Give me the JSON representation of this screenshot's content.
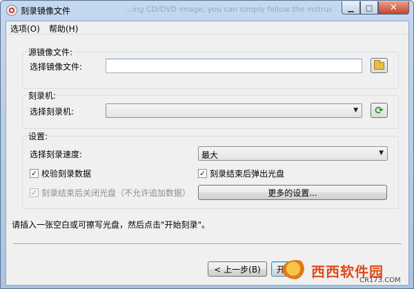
{
  "window": {
    "title": "刻录镜像文件",
    "title_ghost": "...ing CD/DVD image, you can simply follow the instructions in the program to"
  },
  "menu": {
    "options": "选项(O)",
    "help": "帮助(H)"
  },
  "source_group": {
    "title": "源镜像文件:",
    "field_label": "选择镜像文件:",
    "field_value": "",
    "browse_icon": "folder-icon"
  },
  "burner_group": {
    "title": "刻录机:",
    "field_label": "选择刻录机:",
    "selected": "",
    "refresh_icon": "refresh-icon"
  },
  "settings_group": {
    "title": "设置:",
    "speed_label": "选择刻录速度:",
    "speed_selected": "最大",
    "verify_label": "校验刻录数据",
    "verify_checked": true,
    "eject_label": "刻录结束后弹出光盘",
    "eject_checked": true,
    "close_label": "刻录结束后关闭光盘（不允许追加数据）",
    "close_checked": true,
    "close_enabled": false,
    "more_button": "更多的设置..."
  },
  "instruction": "请插入一张空白或可擦写光盘，然后点击\"开始刻录\"。",
  "footer": {
    "back_button": "< 上一步(B)",
    "start_button": "开始"
  },
  "watermark": {
    "brand": "西西软件园",
    "url": "CR173.COM"
  }
}
